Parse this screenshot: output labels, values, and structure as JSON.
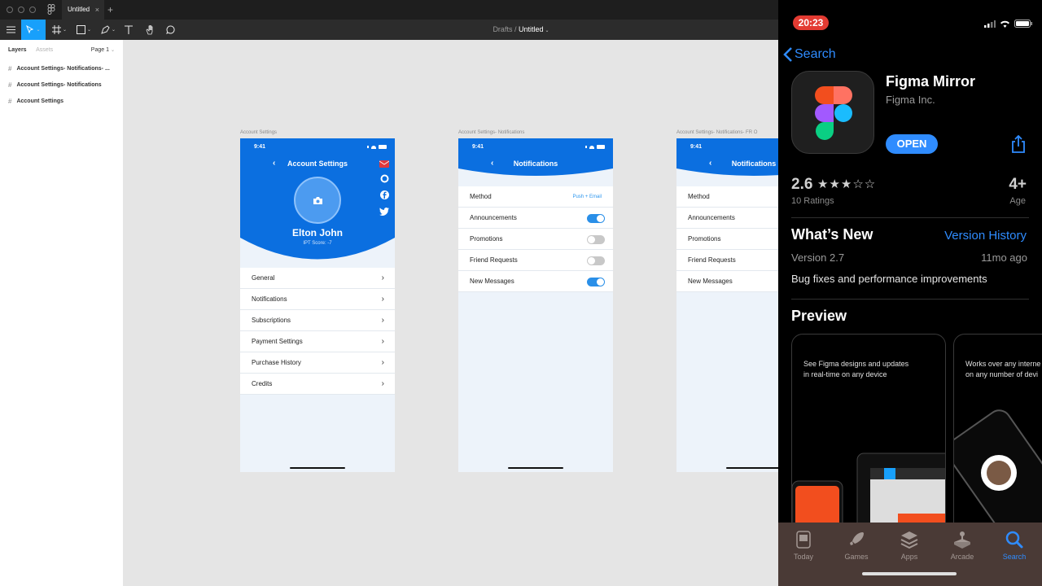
{
  "figma": {
    "tab_title": "Untitled",
    "tab_close": "×",
    "new_tab": "+",
    "breadcrumb": {
      "drafts": "Drafts",
      "sep": "/",
      "file": "Untitled"
    },
    "layers_tab": "Layers",
    "assets_tab": "Assets",
    "page": "Page 1",
    "layers": [
      "Account Settings- Notifications- ...",
      "Account Settings- Notifications",
      "Account Settings"
    ]
  },
  "frames": {
    "account": {
      "label": "Account Settings",
      "time": "9:41",
      "title": "Account Settings",
      "name": "Elton John",
      "score": "IPT Score: -7",
      "items": [
        "General",
        "Notifications",
        "Subscriptions",
        "Payment Settings",
        "Purchase History",
        "Credits"
      ]
    },
    "notifications": {
      "label": "Account Settings- Notifications",
      "time": "9:41",
      "title": "Notifications",
      "rows": [
        {
          "label": "Method",
          "value": "Push + Email"
        },
        {
          "label": "Announcements",
          "on": true
        },
        {
          "label": "Promotions",
          "on": false
        },
        {
          "label": "Friend Requests",
          "on": false
        },
        {
          "label": "New Messages",
          "on": true
        }
      ]
    },
    "notifications2": {
      "label": "Account Settings- Notifications- FR O",
      "time": "9:41",
      "title": "Notifications",
      "rows": [
        "Method",
        "Announcements",
        "Promotions",
        "Friend Requests",
        "New Messages"
      ]
    }
  },
  "phone": {
    "time": "20:23",
    "back": "Search",
    "app_name": "Figma Mirror",
    "developer": "Figma Inc.",
    "open": "OPEN",
    "rating": "2.6",
    "stars": "★★★☆☆",
    "stars_value": 2.6,
    "ratings_count": "10 Ratings",
    "age": "4+",
    "age_label": "Age",
    "whats_new": "What’s New",
    "version_history": "Version History",
    "version": "Version 2.7",
    "ago": "11mo ago",
    "notes": "Bug fixes and performance improvements",
    "preview": "Preview",
    "card1": "See Figma designs and updates\nin real-time on any device",
    "card2": "Works over any interne\non any number of devi",
    "tabs": [
      "Today",
      "Games",
      "Apps",
      "Arcade",
      "Search"
    ],
    "active_tab": "Search"
  },
  "colors": {
    "figma_blue": "#18a0fb",
    "header_blue": "#0b6fe0",
    "ios_blue": "#2f8cff",
    "status_red": "#e33b32"
  }
}
